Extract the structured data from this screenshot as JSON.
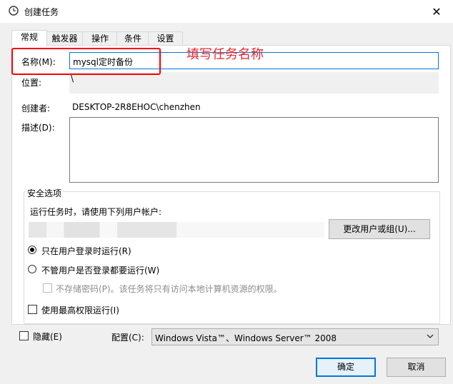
{
  "window": {
    "title": "创建任务",
    "close_glyph": "✕"
  },
  "tabs": [
    {
      "label": "常规",
      "active": true
    },
    {
      "label": "触发器"
    },
    {
      "label": "操作"
    },
    {
      "label": "条件"
    },
    {
      "label": "设置"
    }
  ],
  "general": {
    "name_label": "名称(M):",
    "name_value": "mysql定时备份",
    "location_label": "位置:",
    "location_value": "\\",
    "author_label": "创建者:",
    "author_value": "DESKTOP-2R8EHOC\\chenzhen",
    "description_label": "描述(D):",
    "description_value": ""
  },
  "annotation": {
    "text": "填写任务名称",
    "color": "#e8272f"
  },
  "security": {
    "group_label": "安全选项",
    "run_as_label": "运行任务时，请使用下列用户帐户:",
    "change_user_button": "更改用户或组(U)...",
    "radio_logged_on": "只在用户登录时运行(R)",
    "radio_whether_logged_on": "不管用户是否登录都要运行(W)",
    "no_store_password": "不存储密码(P)。该任务将只有访问本地计算机资源的权限。",
    "highest_privileges": "使用最高权限运行(I)"
  },
  "footer": {
    "hidden_label": "隐藏(E)",
    "configure_label": "配置(C):",
    "configure_value": "Windows Vista™、Windows Server™ 2008",
    "ok_button": "确定",
    "cancel_button": "取消"
  },
  "colors": {
    "accent": "#0078d7",
    "annotation_red": "#ff0000"
  }
}
